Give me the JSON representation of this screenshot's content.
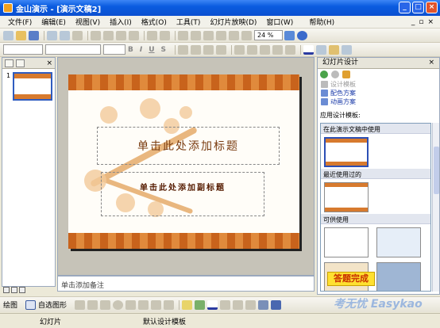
{
  "window": {
    "title": "金山演示 - [演示文稿2]"
  },
  "menubar": {
    "items": [
      "文件(F)",
      "编辑(E)",
      "视图(V)",
      "插入(I)",
      "格式(O)",
      "工具(T)",
      "幻灯片放映(D)",
      "窗口(W)",
      "帮助(H)"
    ]
  },
  "toolbar": {
    "zoom": "24 %"
  },
  "slide": {
    "title_placeholder": "单击此处添加标题",
    "subtitle_placeholder": "单击此处添加副标题"
  },
  "thumbnails": {
    "items": [
      {
        "number": "1"
      }
    ]
  },
  "notes": {
    "placeholder": "单击添加备注"
  },
  "taskpane": {
    "title": "幻灯片设计",
    "links": [
      "设计模板",
      "配色方案",
      "动画方案"
    ],
    "section": "应用设计模板:",
    "groups": [
      "在此演示文稿中使用",
      "最近使用过的",
      "可供使用"
    ]
  },
  "badge": "答题完成",
  "drawbar": {
    "draw_label": "绘图",
    "autoshape_label": "自选图形"
  },
  "status": {
    "view": "幻灯片",
    "template": "默认设计模板"
  },
  "watermark": "考无忧 Easykao"
}
